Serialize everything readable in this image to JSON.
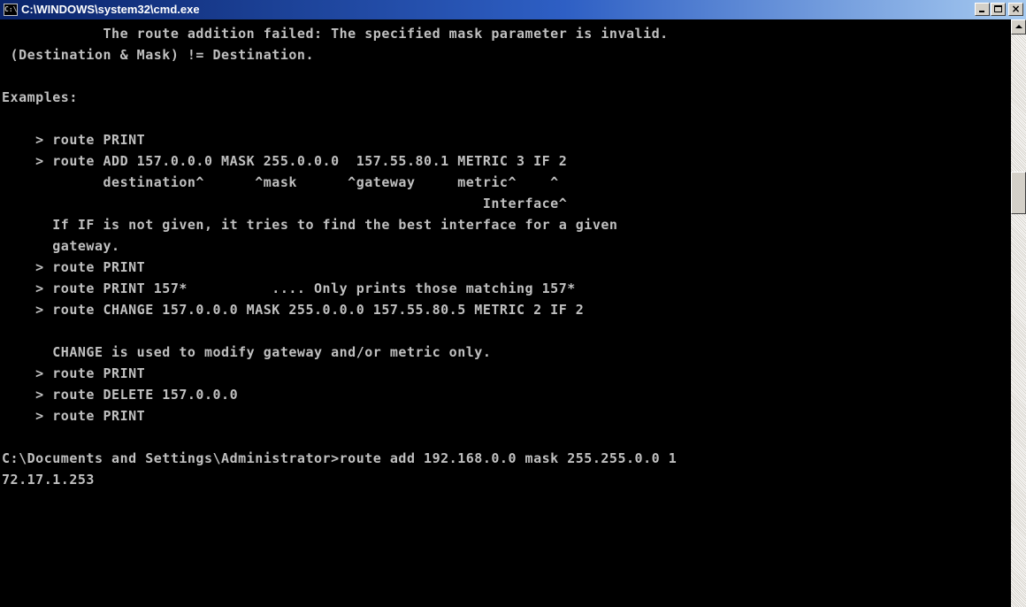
{
  "window": {
    "title": "C:\\WINDOWS\\system32\\cmd.exe",
    "icon": "cmd-icon",
    "icon_text": "C:\\",
    "buttons": {
      "minimize_icon": "minimize-icon",
      "maximize_icon": "maximize-icon",
      "close_icon": "close-icon",
      "close_glyph": "×"
    }
  },
  "console": {
    "background": "#000000",
    "foreground": "#c0c0c0",
    "lines": [
      "            The route addition failed: The specified mask parameter is invalid.",
      " (Destination & Mask) != Destination.",
      "",
      "Examples:",
      "",
      "    > route PRINT",
      "    > route ADD 157.0.0.0 MASK 255.0.0.0  157.55.80.1 METRIC 3 IF 2",
      "            destination^      ^mask      ^gateway     metric^    ^",
      "                                                         Interface^",
      "      If IF is not given, it tries to find the best interface for a given",
      "      gateway.",
      "    > route PRINT",
      "    > route PRINT 157*          .... Only prints those matching 157*",
      "    > route CHANGE 157.0.0.0 MASK 255.0.0.0 157.55.80.5 METRIC 2 IF 2",
      "",
      "      CHANGE is used to modify gateway and/or metric only.",
      "    > route PRINT",
      "    > route DELETE 157.0.0.0",
      "    > route PRINT",
      "",
      "C:\\Documents and Settings\\Administrator>route add 192.168.0.0 mask 255.255.0.0 1",
      "72.17.1.253"
    ]
  },
  "scrollbar": {
    "up_arrow_icon": "scroll-up-arrow-icon",
    "thumb_position": 0.15
  },
  "colors": {
    "titlebar_start": "#0a246a",
    "titlebar_end": "#a6caf0",
    "chrome": "#d4d0c8"
  }
}
